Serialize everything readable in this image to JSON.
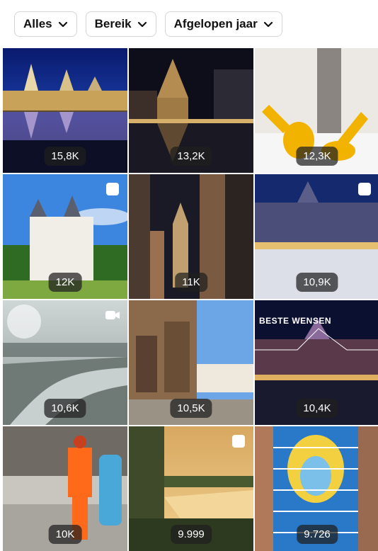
{
  "filters": [
    {
      "label": "Alles"
    },
    {
      "label": "Bereik"
    },
    {
      "label": "Afgelopen jaar"
    }
  ],
  "tiles": [
    {
      "count": "15,8K",
      "media": "none"
    },
    {
      "count": "13,2K",
      "media": "none"
    },
    {
      "count": "12,3K",
      "media": "none"
    },
    {
      "count": "12K",
      "media": "carousel-icon"
    },
    {
      "count": "11K",
      "media": "none"
    },
    {
      "count": "10,9K",
      "media": "carousel-icon"
    },
    {
      "count": "10,6K",
      "media": "video-icon"
    },
    {
      "count": "10,5K",
      "media": "none"
    },
    {
      "count": "10,4K",
      "media": "none",
      "overlay": "BESTE WENSEN"
    },
    {
      "count": "10K",
      "media": "none"
    },
    {
      "count": "9.999",
      "media": "carousel-icon"
    },
    {
      "count": "9.726",
      "media": "none"
    }
  ]
}
